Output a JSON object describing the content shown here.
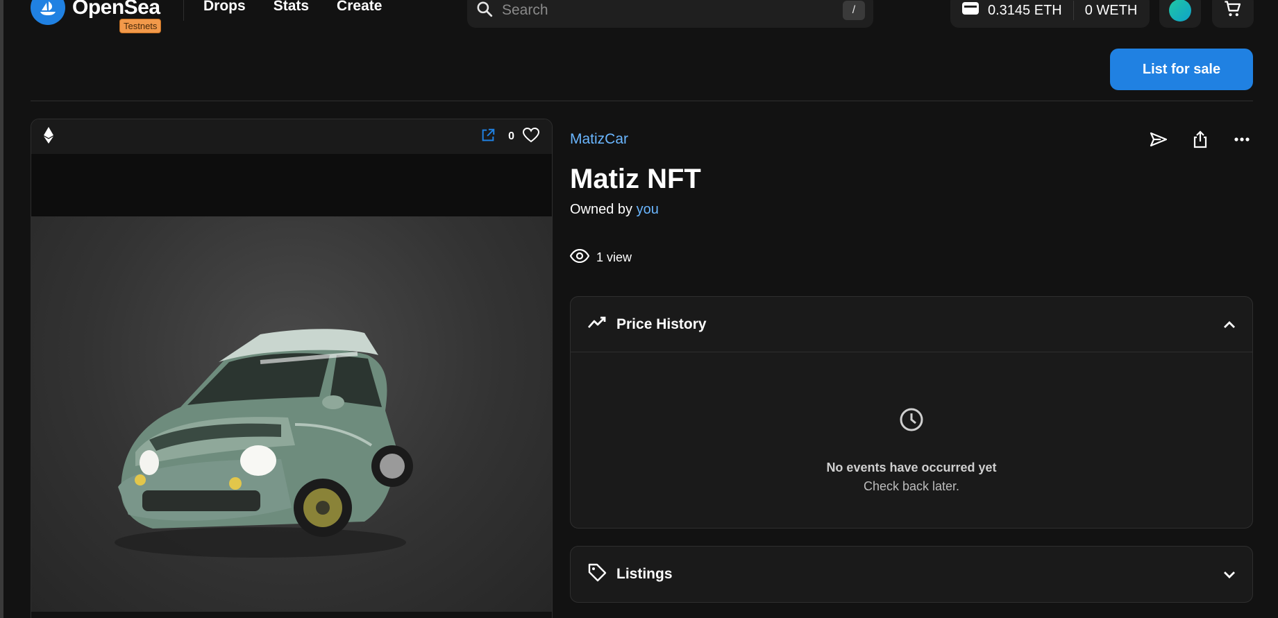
{
  "header": {
    "logo_text": "OpenSea",
    "env_badge": "Testnets",
    "nav": [
      "Drops",
      "Stats",
      "Create"
    ],
    "search_placeholder": "Search",
    "search_shortcut": "/",
    "wallet": {
      "eth": "0.3145 ETH",
      "weth": "0 WETH"
    }
  },
  "toolbar": {
    "list_for_sale": "List for sale"
  },
  "media": {
    "favorites_count": "0"
  },
  "item": {
    "collection": "MatizCar",
    "title": "Matiz NFT",
    "owned_by_label": "Owned by",
    "owner": "you",
    "views": "1 view"
  },
  "price_history": {
    "title": "Price History",
    "empty_title": "No events have occurred yet",
    "empty_sub": "Check back later."
  },
  "listings": {
    "title": "Listings"
  },
  "colors": {
    "accent": "#2081e2",
    "link": "#6ab6ff",
    "badge": "#f2994a",
    "background": "#121212"
  }
}
